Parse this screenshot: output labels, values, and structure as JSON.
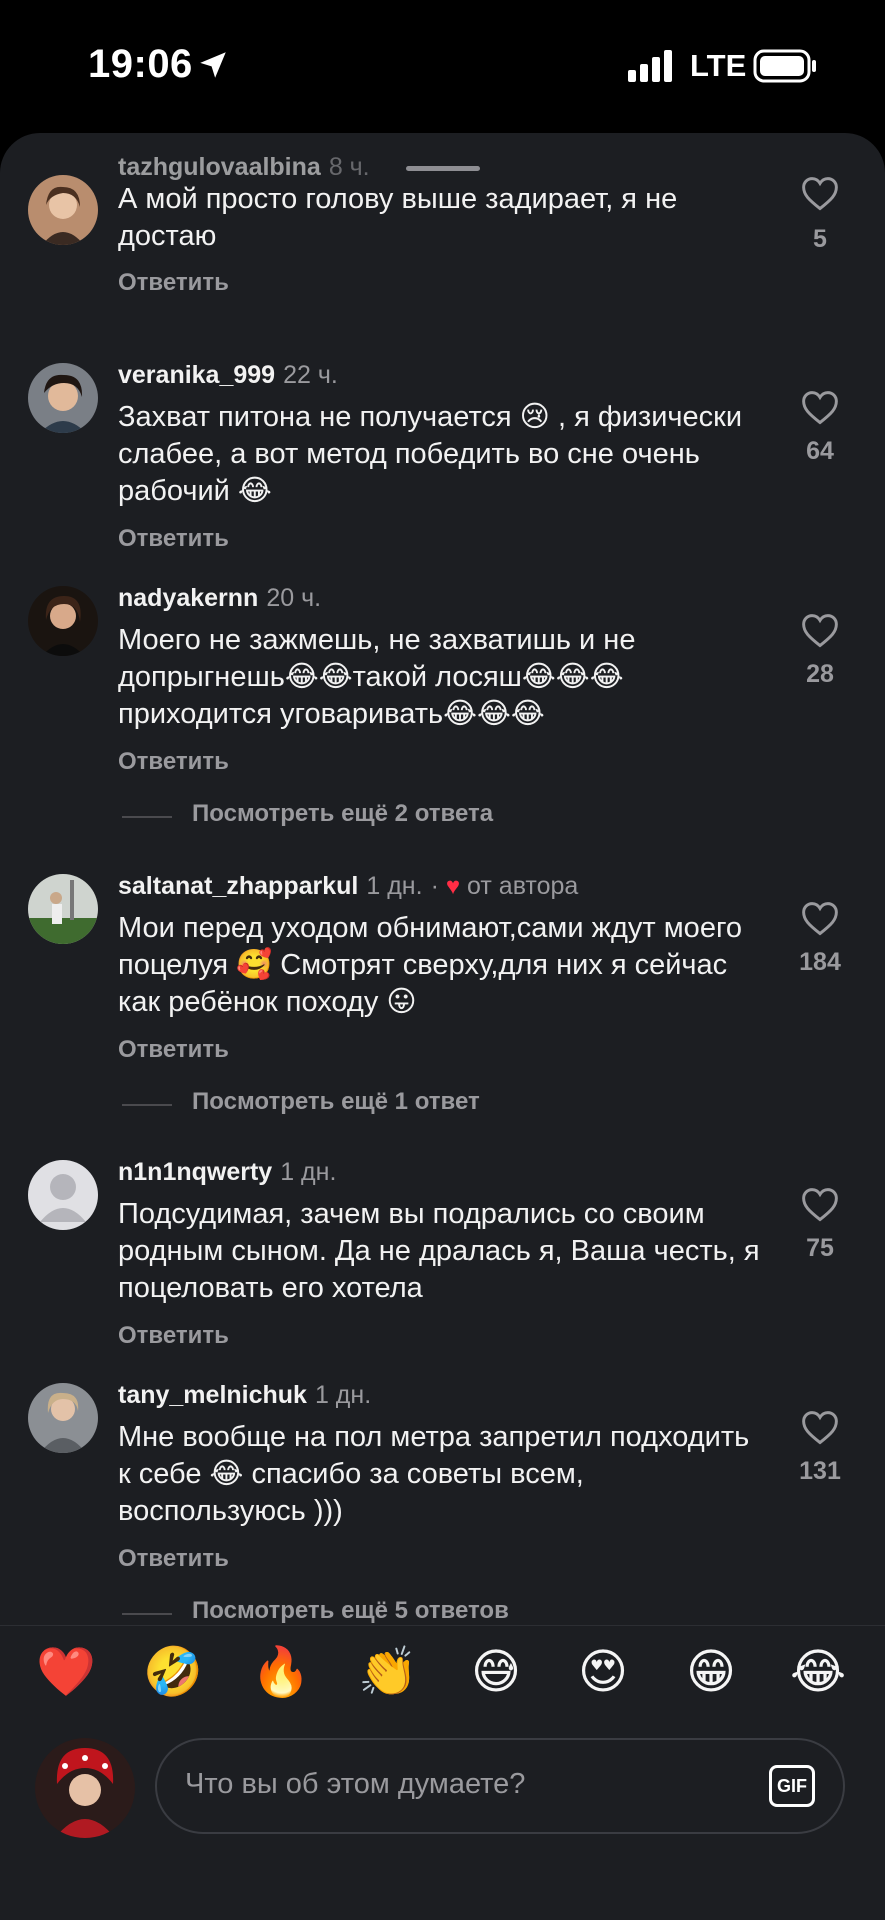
{
  "status": {
    "time": "19:06",
    "network": "LTE"
  },
  "comments": [
    {
      "username": "tazhgulovaalbina",
      "time": "8 ч.",
      "text": "А мой просто голову выше задирает, я не достаю",
      "reply": "Ответить",
      "likes": "5"
    },
    {
      "username": "veranika_999",
      "time": "22 ч.",
      "text": "Захват питона не получается 😢 , я физически слабее, а вот метод победить во сне очень рабочий 😂",
      "reply": "Ответить",
      "likes": "64"
    },
    {
      "username": "nadyakernn",
      "time": "20 ч.",
      "text": "Моего не зажмешь, не захватишь и не допрыгнешь😂😂такой лосяш😂😂😂 приходится уговаривать😂😂😂",
      "reply": "Ответить",
      "likes": "28",
      "more": "Посмотреть ещё 2 ответа"
    },
    {
      "username": "saltanat_zhapparkul",
      "time": "1 дн.",
      "author_like": "от автора",
      "text": "Мои перед уходом обнимают,сами ждут моего поцелуя 🥰 Смотрят сверху,для них я сейчас как ребёнок походу 😛",
      "reply": "Ответить",
      "likes": "184",
      "more": "Посмотреть ещё 1 ответ"
    },
    {
      "username": "n1n1nqwerty",
      "time": "1 дн.",
      "text": "Подсудимая, зачем вы подрались со своим родным сыном. Да не дралась я, Ваша честь, я поцеловать его хотела",
      "reply": "Ответить",
      "likes": "75"
    },
    {
      "username": "tany_melnichuk",
      "time": "1 дн.",
      "text": "Мне вообще на пол метра запретил подходить к себе 😂 спасибо за советы всем, воспользуюсь )))",
      "reply": "Ответить",
      "likes": "131",
      "more": "Посмотреть ещё 5 ответов"
    }
  ],
  "reactions": [
    "❤️",
    "🤣",
    "🔥",
    "👏",
    "😅",
    "😍",
    "😁",
    "😂"
  ],
  "input": {
    "placeholder": "Что вы об этом думаете?",
    "gif_label": "GIF"
  },
  "colors": {
    "background": "#1c1e22",
    "text": "#f2f2f2",
    "muted": "#9a9a9e",
    "like_red": "#ff2d45"
  }
}
